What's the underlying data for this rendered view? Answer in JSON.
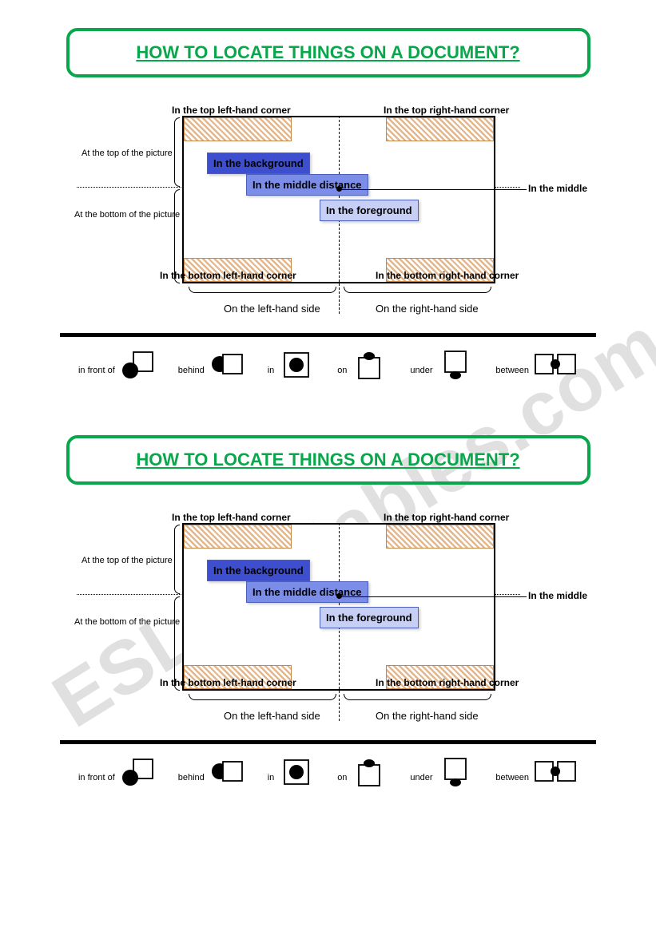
{
  "watermark": "ESLprintables.com",
  "title": "HOW TO LOCATE THINGS ON A DOCUMENT?",
  "corners": {
    "top_left": "In the top left-hand corner",
    "top_right": "In the top right-hand corner",
    "bottom_left": "In the bottom left-hand corner",
    "bottom_right": "In the bottom right-hand corner"
  },
  "depth": {
    "background": "In the background",
    "middle": "In the middle distance",
    "foreground": "In the foreground"
  },
  "halves": {
    "top": "At the top of the picture",
    "bottom": "At the bottom of the picture"
  },
  "sides": {
    "left": "On the left-hand side",
    "right": "On the right-hand side"
  },
  "center": "In the middle",
  "prepositions": {
    "in_front_of": "in front of",
    "behind": "behind",
    "in": "in",
    "on": "on",
    "under": "under",
    "between": "between"
  }
}
